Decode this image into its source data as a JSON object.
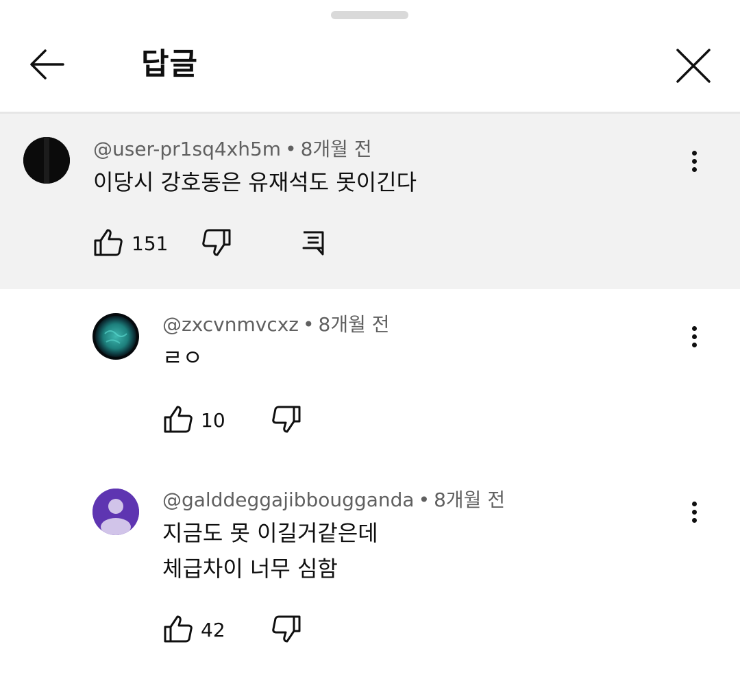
{
  "header": {
    "title": "답글"
  },
  "comments": [
    {
      "author": "@user-pr1sq4xh5m",
      "separator": "•",
      "time": "8개월 전",
      "lines": [
        "이당시 강호동은 유재석도 못이긴다"
      ],
      "likes": "151"
    },
    {
      "author": "@zxcvnmvcxz",
      "separator": "•",
      "time": "8개월 전",
      "lines": [
        "ㄹㅇ"
      ],
      "likes": "10"
    },
    {
      "author": "@galddeggajibbouggandа",
      "separator": "•",
      "time": "8개월 전",
      "lines": [
        "지금도 못 이길거같은데",
        "체급차이 너무 심함"
      ],
      "likes": "42"
    }
  ],
  "icons": {
    "back": "arrow-left-icon",
    "close": "close-icon",
    "more": "more-vertical-icon",
    "like": "thumb-up-icon",
    "dislike": "thumb-down-icon",
    "reply": "reply-icon"
  },
  "colors": {
    "parent_bg": "#f2f2f2",
    "meta_text": "#606060",
    "primary_text": "#0f0f0f",
    "avatar_default": "#5e35b1"
  }
}
